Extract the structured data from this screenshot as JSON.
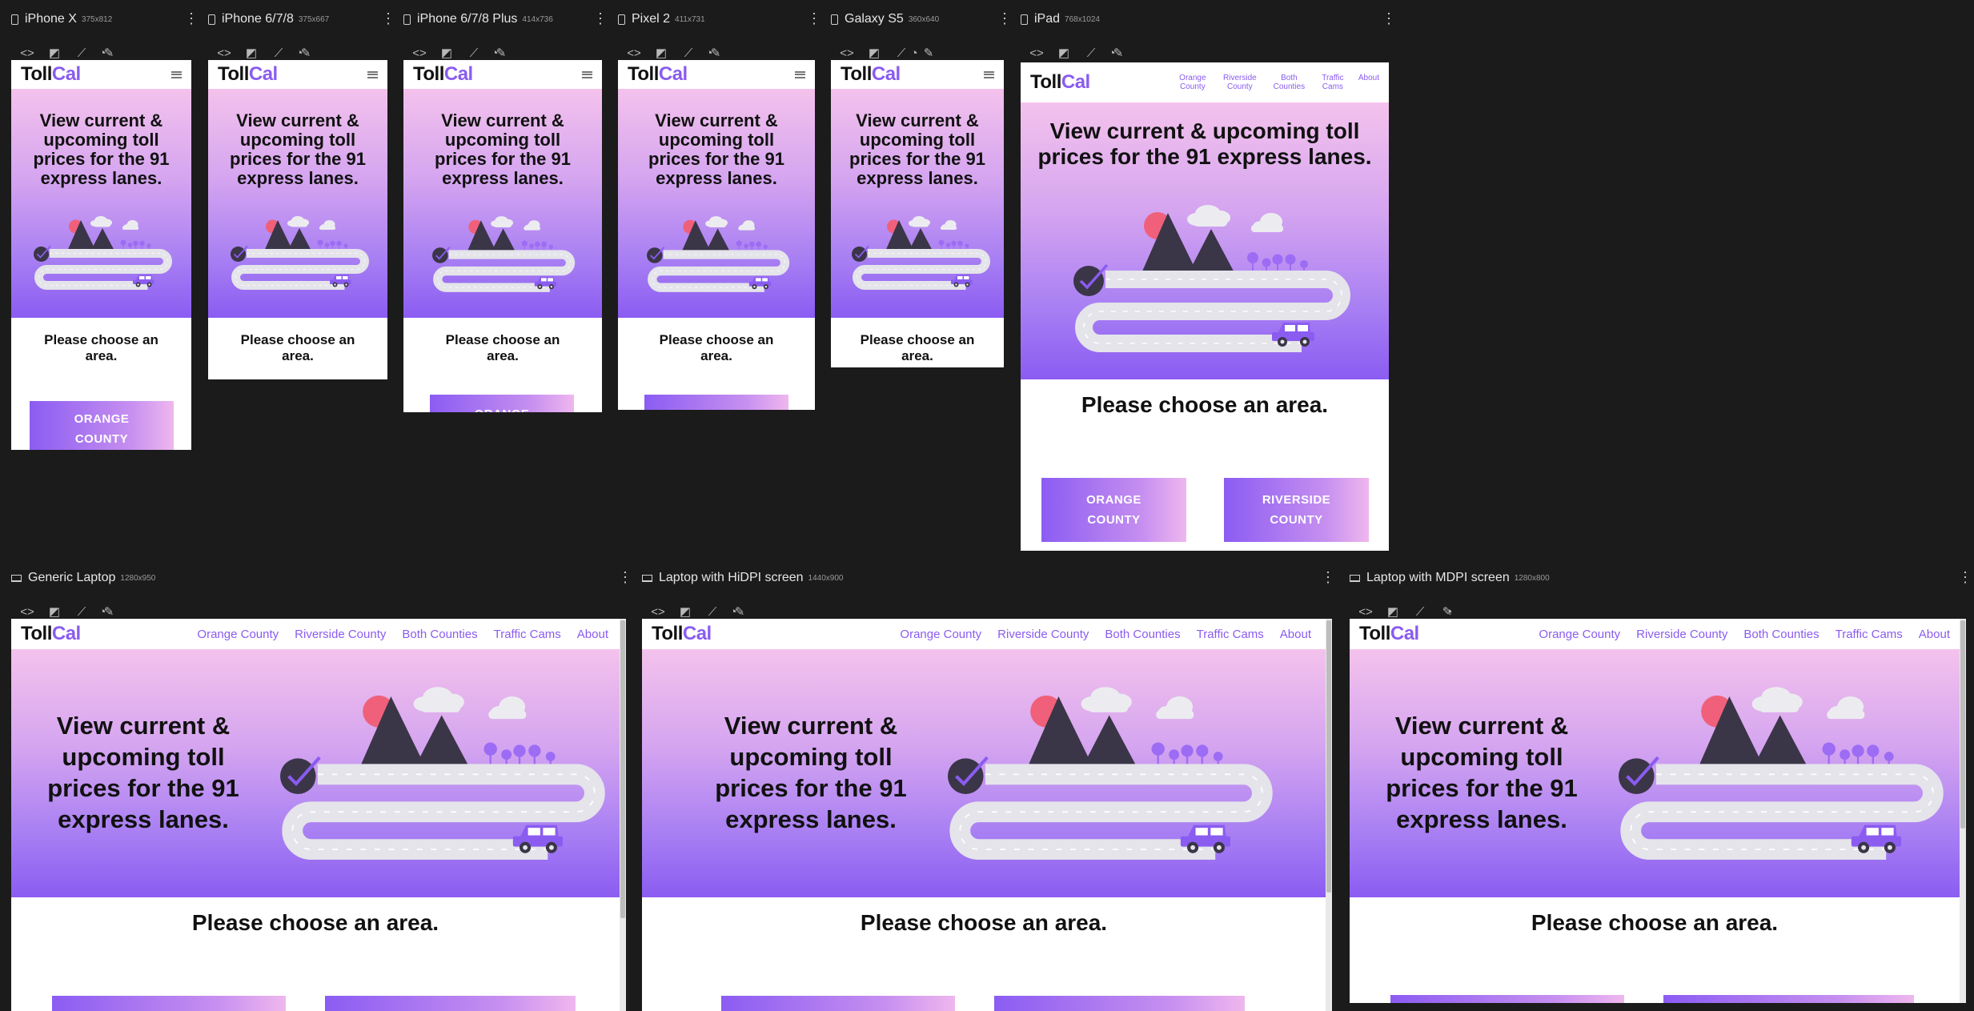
{
  "site": {
    "logo_toll": "Toll",
    "logo_cal": "Cal",
    "hero_text": "View current & upcoming toll prices for the 91 express lanes.",
    "choose_text": "Please choose an area.",
    "nav": [
      "Orange County",
      "Riverside County",
      "Both Counties",
      "Traffic Cams",
      "About"
    ],
    "buttons": [
      "ORANGE COUNTY",
      "RIVERSIDE COUNTY"
    ]
  },
  "devices": [
    {
      "name": "iPhone X",
      "dims": "375x812"
    },
    {
      "name": "iPhone 6/7/8",
      "dims": "375x667"
    },
    {
      "name": "iPhone 6/7/8 Plus",
      "dims": "414x736"
    },
    {
      "name": "Pixel 2",
      "dims": "411x731"
    },
    {
      "name": "Galaxy S5",
      "dims": "360x640"
    },
    {
      "name": "iPad",
      "dims": "768x1024"
    },
    {
      "name": "Generic Laptop",
      "dims": "1280x950"
    },
    {
      "name": "Laptop with HiDPI screen",
      "dims": "1440x900"
    },
    {
      "name": "Laptop with MDPI screen",
      "dims": "1280x800"
    }
  ],
  "toolbar_icons": [
    "code-icon",
    "screenshot-icon",
    "eyedropper-icon",
    "edit-icon"
  ],
  "colors": {
    "accent": "#8a5cf0",
    "gradient_top": "#f4c2ec",
    "gradient_bottom": "#8b5cf2",
    "mountain": "#3b3548",
    "sun": "#f0607a",
    "tree": "#9d6cf4",
    "road": "#e4e4ea",
    "car": "#8a5cf0"
  }
}
